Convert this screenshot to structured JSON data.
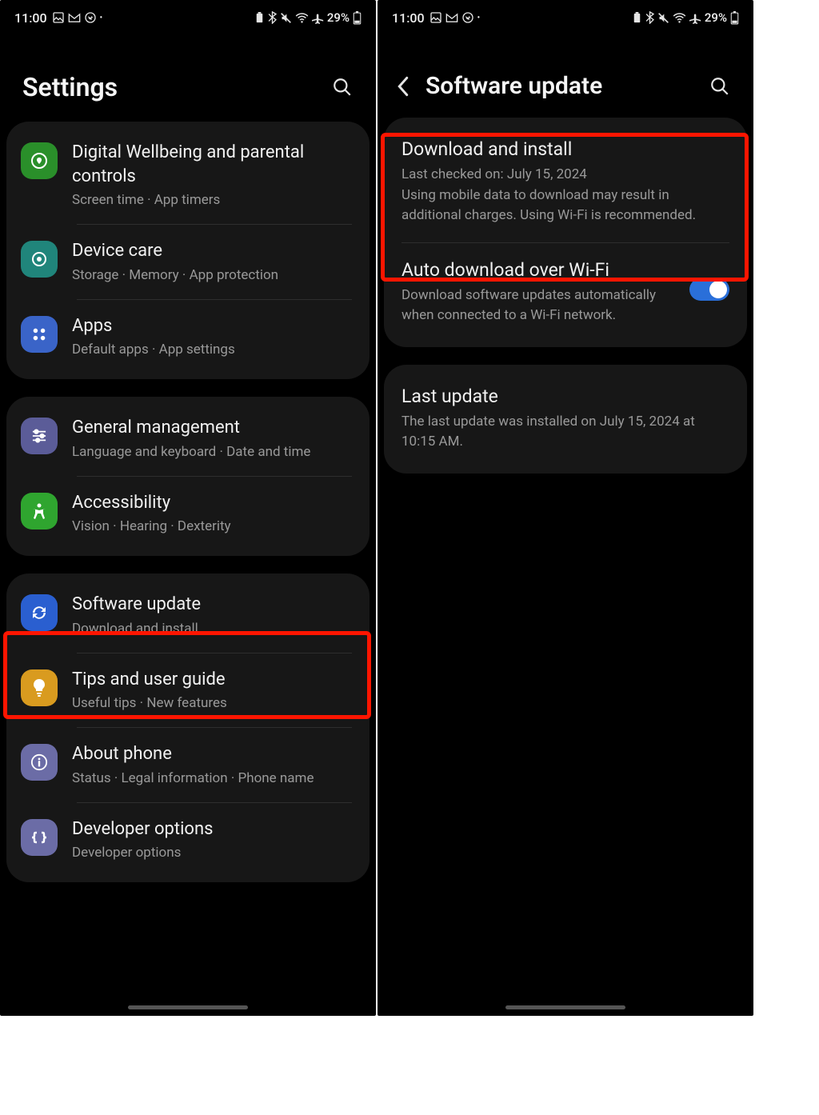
{
  "statusbar": {
    "time": "11:00",
    "battery": "29%"
  },
  "left": {
    "title": "Settings",
    "groups": [
      {
        "items": [
          {
            "id": "wellbeing",
            "title": "Digital Wellbeing and parental controls",
            "sub": "Screen time  ·  App timers",
            "iconClass": "ic-green"
          },
          {
            "id": "devicecare",
            "title": "Device care",
            "sub": "Storage  ·  Memory  ·  App protection",
            "iconClass": "ic-teal"
          },
          {
            "id": "apps",
            "title": "Apps",
            "sub": "Default apps  ·  App settings",
            "iconClass": "ic-blue"
          }
        ]
      },
      {
        "items": [
          {
            "id": "general",
            "title": "General management",
            "sub": "Language and keyboard  ·  Date and time",
            "iconClass": "ic-purple"
          },
          {
            "id": "accessibility",
            "title": "Accessibility",
            "sub": "Vision  ·  Hearing  ·  Dexterity",
            "iconClass": "ic-green2"
          }
        ]
      },
      {
        "items": [
          {
            "id": "swupdate",
            "title": "Software update",
            "sub": "Download and install",
            "iconClass": "ic-blue2"
          },
          {
            "id": "tips",
            "title": "Tips and user guide",
            "sub": "Useful tips  ·  New features",
            "iconClass": "ic-yellow"
          },
          {
            "id": "about",
            "title": "About phone",
            "sub": "Status  ·  Legal information  ·  Phone name",
            "iconClass": "ic-purple2"
          },
          {
            "id": "developer",
            "title": "Developer options",
            "sub": "Developer options",
            "iconClass": "ic-purple2"
          }
        ]
      }
    ]
  },
  "right": {
    "title": "Software update",
    "download": {
      "title": "Download and install",
      "line1": "Last checked on: July 15, 2024",
      "line2": "Using mobile data to download may result in additional charges. Using Wi-Fi is recommended."
    },
    "auto": {
      "title": "Auto download over Wi-Fi",
      "sub": "Download software updates automatically when connected to a Wi-Fi network.",
      "enabled": true
    },
    "last": {
      "title": "Last update",
      "sub": "The last update was installed on July 15, 2024 at 10:15 AM."
    }
  }
}
